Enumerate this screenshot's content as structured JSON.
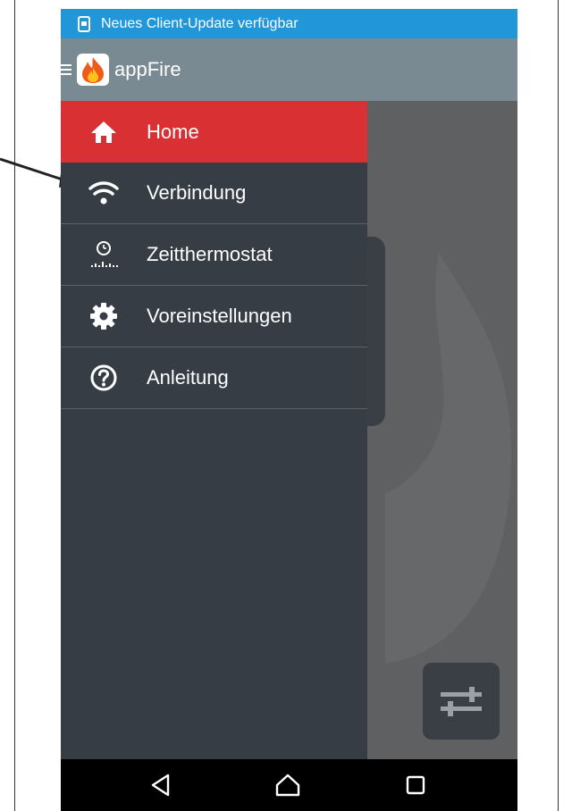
{
  "status_bar": {
    "notification": "Neues Client-Update verfügbar",
    "color": "#2196d9"
  },
  "app_bar": {
    "title": "appFire",
    "color": "#7a8a93"
  },
  "drawer": {
    "active_color": "#d93033",
    "items": [
      {
        "label": "Home",
        "icon": "home-icon",
        "active": true
      },
      {
        "label": "Verbindung",
        "icon": "wifi-icon",
        "active": false
      },
      {
        "label": "Zeitthermostat",
        "icon": "timer-icon",
        "active": false
      },
      {
        "label": "Voreinstellungen",
        "icon": "gear-icon",
        "active": false
      },
      {
        "label": "Anleitung",
        "icon": "help-icon",
        "active": false
      }
    ]
  },
  "content": {
    "fab_icon": "sliders-icon"
  },
  "nav_bar": {
    "buttons": [
      "back-icon",
      "home-icon",
      "recents-icon"
    ]
  }
}
